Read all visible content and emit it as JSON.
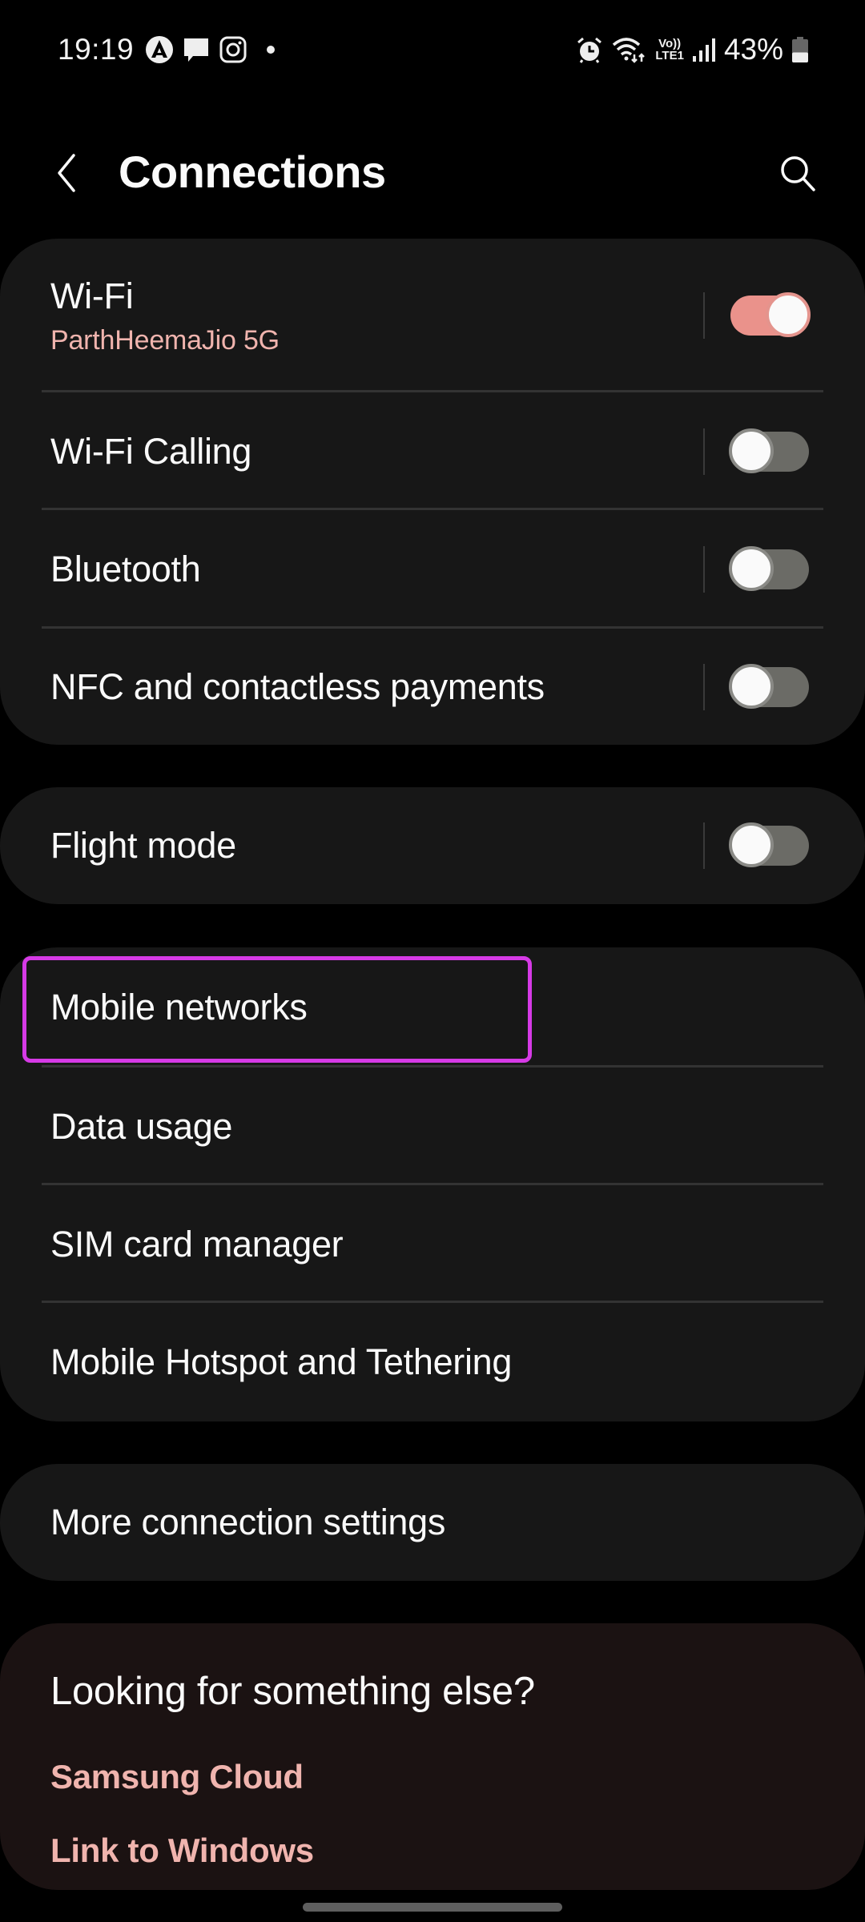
{
  "status_bar": {
    "time": "19:19",
    "left_icons": [
      "app-a-icon",
      "message-icon",
      "instagram-icon",
      "notification-dot"
    ],
    "right_icons": [
      "alarm-icon",
      "wifi-data-icon",
      "volte-lte-icon",
      "signal-icon",
      "battery-icon"
    ],
    "volte_label_top": "Vo))",
    "volte_label_bottom": "LTE1",
    "battery_percent": "43%",
    "battery_level": 0.43
  },
  "header": {
    "title": "Connections",
    "back_icon": "chevron-left-icon",
    "search_icon": "search-icon"
  },
  "groups": [
    {
      "items": [
        {
          "label": "Wi-Fi",
          "subtitle": "ParthHeemaJio 5G",
          "toggle": true,
          "on": true
        },
        {
          "label": "Wi-Fi Calling",
          "toggle": true,
          "on": false
        },
        {
          "label": "Bluetooth",
          "toggle": true,
          "on": false
        },
        {
          "label": "NFC and contactless payments",
          "toggle": true,
          "on": false
        }
      ]
    },
    {
      "items": [
        {
          "label": "Flight mode",
          "toggle": true,
          "on": false
        }
      ]
    },
    {
      "items": [
        {
          "label": "Mobile networks",
          "highlighted": true
        },
        {
          "label": "Data usage"
        },
        {
          "label": "SIM card manager"
        },
        {
          "label": "Mobile Hotspot and Tethering"
        }
      ]
    },
    {
      "items": [
        {
          "label": "More connection settings"
        }
      ]
    }
  ],
  "suggestions": {
    "title": "Looking for something else?",
    "links": [
      "Samsung Cloud",
      "Link to Windows"
    ]
  },
  "colors": {
    "accent": "#ea928b",
    "subtitle_accent": "#f0b4ae",
    "highlight_box": "#d63ae6",
    "card_bg": "#171717",
    "suggest_bg": "#1b1212"
  }
}
